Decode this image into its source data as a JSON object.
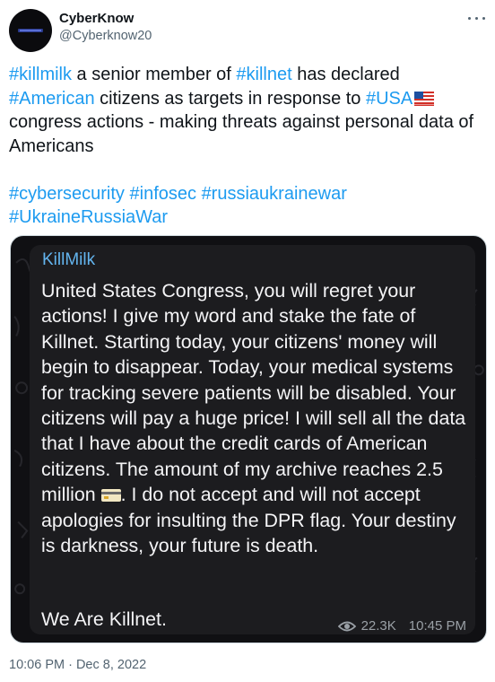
{
  "author": {
    "display_name": "CyberKnow",
    "handle": "@Cyberknow20"
  },
  "tweet": {
    "line1": [
      {
        "text": "#killmilk",
        "hashtag": true
      },
      {
        "text": " a senior member of ",
        "hashtag": false
      },
      {
        "text": "#killnet",
        "hashtag": true
      },
      {
        "text": " has declared ",
        "hashtag": false
      },
      {
        "text": "#American",
        "hashtag": true
      },
      {
        "text": " citizens as targets in response to ",
        "hashtag": false
      },
      {
        "text": "#USA",
        "hashtag": true
      }
    ],
    "line1_tail": "congress actions - making threats against personal data of Americans",
    "hashtags": [
      "#cybersecurity",
      "#infosec",
      "#russiaukrainewar",
      "#UkraineRussiaWar"
    ],
    "timestamp": "10:06 PM · Dec 8, 2022"
  },
  "media": {
    "sender": "KillMilk",
    "message_part1": "United States Congress, you will regret your actions! I give my word and stake the fate of Killnet. Starting today, your citizens' money will begin to disappear. Today, your medical systems for tracking severe patients will be disabled. Your citizens will pay a huge price! I will sell all the data that I have about the credit cards of American citizens. The amount of my archive reaches 2.5 million",
    "message_part2": ". I do not accept and will not accept apologies for insulting the DPR flag. Your destiny is darkness, your future is death.",
    "signoff": "We Are Killnet.",
    "views": "22.3K",
    "time": "10:45 PM"
  },
  "icons": {
    "more": "more-horizontal-icon",
    "flag": "us-flag-emoji",
    "card": "credit-card-emoji",
    "views": "eye-icon"
  },
  "colors": {
    "hashtag": "#1d9bf0",
    "sender": "#63b4ee",
    "bubble": "#1c1c1f",
    "media_bg": "#101013"
  }
}
